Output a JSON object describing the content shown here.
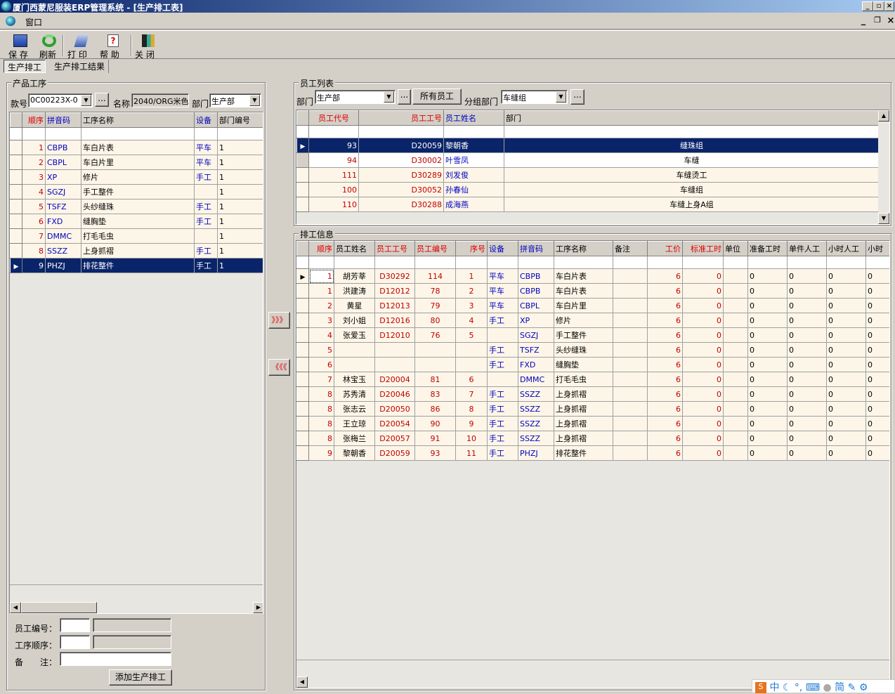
{
  "window": {
    "title": "厦门西蒙尼服装ERP管理系统 - [生产排工表]"
  },
  "menu": {
    "window": "窗口"
  },
  "toolbar": {
    "save": "保 存",
    "refresh": "刷新",
    "print": "打 印",
    "help": "帮 助",
    "close": "关 闭"
  },
  "tabs": [
    "生产排工",
    "生产排工结果"
  ],
  "product": {
    "group_label": "产品工序",
    "style_label": "款号",
    "style_value": "0C00223X-0",
    "name_label": "名称",
    "name_value": "2040/ORG米色",
    "dept_label": "部门",
    "dept_value": "生产部",
    "ellipsis": "...",
    "columns": [
      "顺序",
      "拼音码",
      "工序名称",
      "设备",
      "部门编号"
    ],
    "rows": [
      [
        "1",
        "CBPB",
        "车白片表",
        "平车",
        "1"
      ],
      [
        "2",
        "CBPL",
        "车白片里",
        "平车",
        "1"
      ],
      [
        "3",
        "XP",
        "修片",
        "手工",
        "1"
      ],
      [
        "4",
        "SGZJ",
        "手工整件",
        "",
        "1"
      ],
      [
        "5",
        "TSFZ",
        "头纱缝珠",
        "手工",
        "1"
      ],
      [
        "6",
        "FXD",
        "缝胸垫",
        "手工",
        "1"
      ],
      [
        "7",
        "DMMC",
        "打毛毛虫",
        "",
        "1"
      ],
      [
        "8",
        "SSZZ",
        "上身抓褶",
        "手工",
        "1"
      ],
      [
        "9",
        "PHZJ",
        "排花整件",
        "手工",
        "1"
      ]
    ],
    "selected_index": 8
  },
  "form": {
    "emp_no_label": "员工编号：",
    "seq_label": "工序顺序：",
    "note_label": "备　　注：",
    "add_button": "添加生产排工"
  },
  "transfer": {
    "add": "》》》",
    "remove": "《《《"
  },
  "employees": {
    "group_label": "员工列表",
    "dept_label": "部门",
    "dept_value": "生产部",
    "all_button": "所有员工",
    "subdept_label": "分组部门",
    "subdept_value": "车缝组",
    "ellipsis": "...",
    "columns": [
      "员工代号",
      "员工工号",
      "员工姓名",
      "部门"
    ],
    "rows": [
      [
        "93",
        "D20059",
        "黎朝香",
        "缝珠组"
      ],
      [
        "94",
        "D30002",
        "叶雪凤",
        "车缝"
      ],
      [
        "111",
        "D30289",
        "刘发俊",
        "车缝烫工"
      ],
      [
        "100",
        "D30052",
        "孙春仙",
        "车缝组"
      ],
      [
        "110",
        "D30288",
        "成海燕",
        "车缝上身A组"
      ]
    ],
    "selected_index": 0
  },
  "schedule": {
    "group_label": "排工信息",
    "columns": [
      "顺序",
      "员工姓名",
      "员工工号",
      "员工编号",
      "序号",
      "设备",
      "拼音码",
      "工序名称",
      "备注",
      "工价",
      "标准工时",
      "单位",
      "准备工时",
      "单件人工",
      "小时人工",
      "小时"
    ],
    "rows": [
      [
        "1",
        "胡芳莘",
        "D30292",
        "114",
        "1",
        "平车",
        "CBPB",
        "车白片表",
        "",
        "6",
        "0",
        "",
        "0",
        "0",
        "0",
        "0"
      ],
      [
        "1",
        "洪建涛",
        "D12012",
        "78",
        "2",
        "平车",
        "CBPB",
        "车白片表",
        "",
        "6",
        "0",
        "",
        "0",
        "0",
        "0",
        "0"
      ],
      [
        "2",
        "黄星",
        "D12013",
        "79",
        "3",
        "平车",
        "CBPL",
        "车白片里",
        "",
        "6",
        "0",
        "",
        "0",
        "0",
        "0",
        "0"
      ],
      [
        "3",
        "刘小姐",
        "D12016",
        "80",
        "4",
        "手工",
        "XP",
        "修片",
        "",
        "6",
        "0",
        "",
        "0",
        "0",
        "0",
        "0"
      ],
      [
        "4",
        "张爱玉",
        "D12010",
        "76",
        "5",
        "",
        "SGZJ",
        "手工整件",
        "",
        "6",
        "0",
        "",
        "0",
        "0",
        "0",
        "0"
      ],
      [
        "5",
        "",
        "",
        "",
        "",
        "手工",
        "TSFZ",
        "头纱缝珠",
        "",
        "6",
        "0",
        "",
        "0",
        "0",
        "0",
        "0"
      ],
      [
        "6",
        "",
        "",
        "",
        "",
        "手工",
        "FXD",
        "缝胸垫",
        "",
        "6",
        "0",
        "",
        "0",
        "0",
        "0",
        "0"
      ],
      [
        "7",
        "林宝玉",
        "D20004",
        "81",
        "6",
        "",
        "DMMC",
        "打毛毛虫",
        "",
        "6",
        "0",
        "",
        "0",
        "0",
        "0",
        "0"
      ],
      [
        "8",
        "苏秀清",
        "D20046",
        "83",
        "7",
        "手工",
        "SSZZ",
        "上身抓褶",
        "",
        "6",
        "0",
        "",
        "0",
        "0",
        "0",
        "0"
      ],
      [
        "8",
        "张志云",
        "D20050",
        "86",
        "8",
        "手工",
        "SSZZ",
        "上身抓褶",
        "",
        "6",
        "0",
        "",
        "0",
        "0",
        "0",
        "0"
      ],
      [
        "8",
        "王立琼",
        "D20054",
        "90",
        "9",
        "手工",
        "SSZZ",
        "上身抓褶",
        "",
        "6",
        "0",
        "",
        "0",
        "0",
        "0",
        "0"
      ],
      [
        "8",
        "张梅兰",
        "D20057",
        "91",
        "10",
        "手工",
        "SSZZ",
        "上身抓褶",
        "",
        "6",
        "0",
        "",
        "0",
        "0",
        "0",
        "0"
      ],
      [
        "9",
        "黎朝香",
        "D20059",
        "93",
        "11",
        "手工",
        "PHZJ",
        "排花整件",
        "",
        "6",
        "0",
        "",
        "0",
        "0",
        "0",
        "0"
      ]
    ]
  },
  "tray": {
    "items": [
      "中",
      "简"
    ]
  }
}
